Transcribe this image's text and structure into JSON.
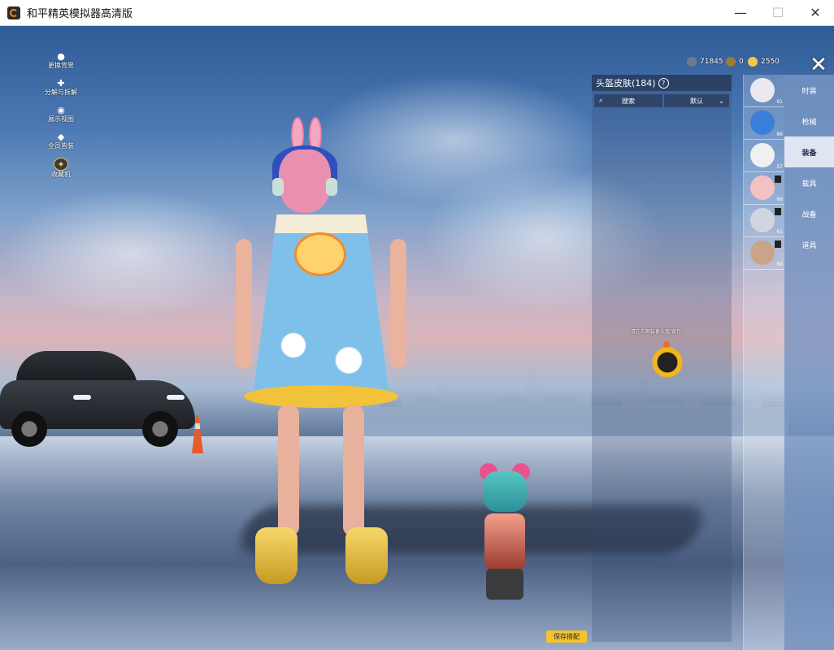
{
  "window": {
    "title": "和平精英模拟器高清版",
    "minimize_glyph": "—",
    "maximize_glyph": "☐",
    "close_glyph": "✕"
  },
  "left_menu": [
    {
      "label": "更换背景",
      "icon": "user-icon"
    },
    {
      "label": "分解与拆解",
      "icon": "puzzle-icon"
    },
    {
      "label": "展示视图",
      "icon": "eye-icon"
    },
    {
      "label": "全员皆装",
      "icon": "droplet-icon"
    },
    {
      "label": "收藏机",
      "icon": "medal-icon"
    }
  ],
  "currencies": [
    {
      "value": "71845",
      "icon": "coin-icon",
      "color": "#6b7b8f"
    },
    {
      "value": "0",
      "icon": "token-icon",
      "color": "#9c7a3a"
    },
    {
      "value": "2550",
      "icon": "gem-icon",
      "color": "#f2c94c"
    }
  ],
  "panel": {
    "title": "头盔皮肤",
    "count": "(184)",
    "help": "?",
    "search_label": "搜索",
    "sort_label": "默认",
    "hint_text": "请在右侧装备头盔/背包"
  },
  "items": [
    {
      "count": "61",
      "icon": "panda-helmet-icon",
      "color": "#e9e9ef"
    },
    {
      "count": "66",
      "icon": "blue-helmet-icon",
      "color": "#3a7fd9"
    },
    {
      "count": "57",
      "icon": "white-helmet-icon",
      "color": "#f0f0f0"
    },
    {
      "count": "66",
      "icon": "pig-helmet-icon",
      "color": "#f3c0c4"
    },
    {
      "count": "61",
      "icon": "cat-helmet-icon",
      "color": "#d0d6e0"
    },
    {
      "count": "68",
      "icon": "bunny-helmet-icon",
      "color": "#caa48a"
    }
  ],
  "tabs": [
    {
      "label": "时装",
      "active": false
    },
    {
      "label": "枪械",
      "active": false
    },
    {
      "label": "装备",
      "active": true
    },
    {
      "label": "载具",
      "active": false
    },
    {
      "label": "战备",
      "active": false
    },
    {
      "label": "道具",
      "active": false
    }
  ],
  "save_button": "保存搭配",
  "close_glyph": "✕"
}
